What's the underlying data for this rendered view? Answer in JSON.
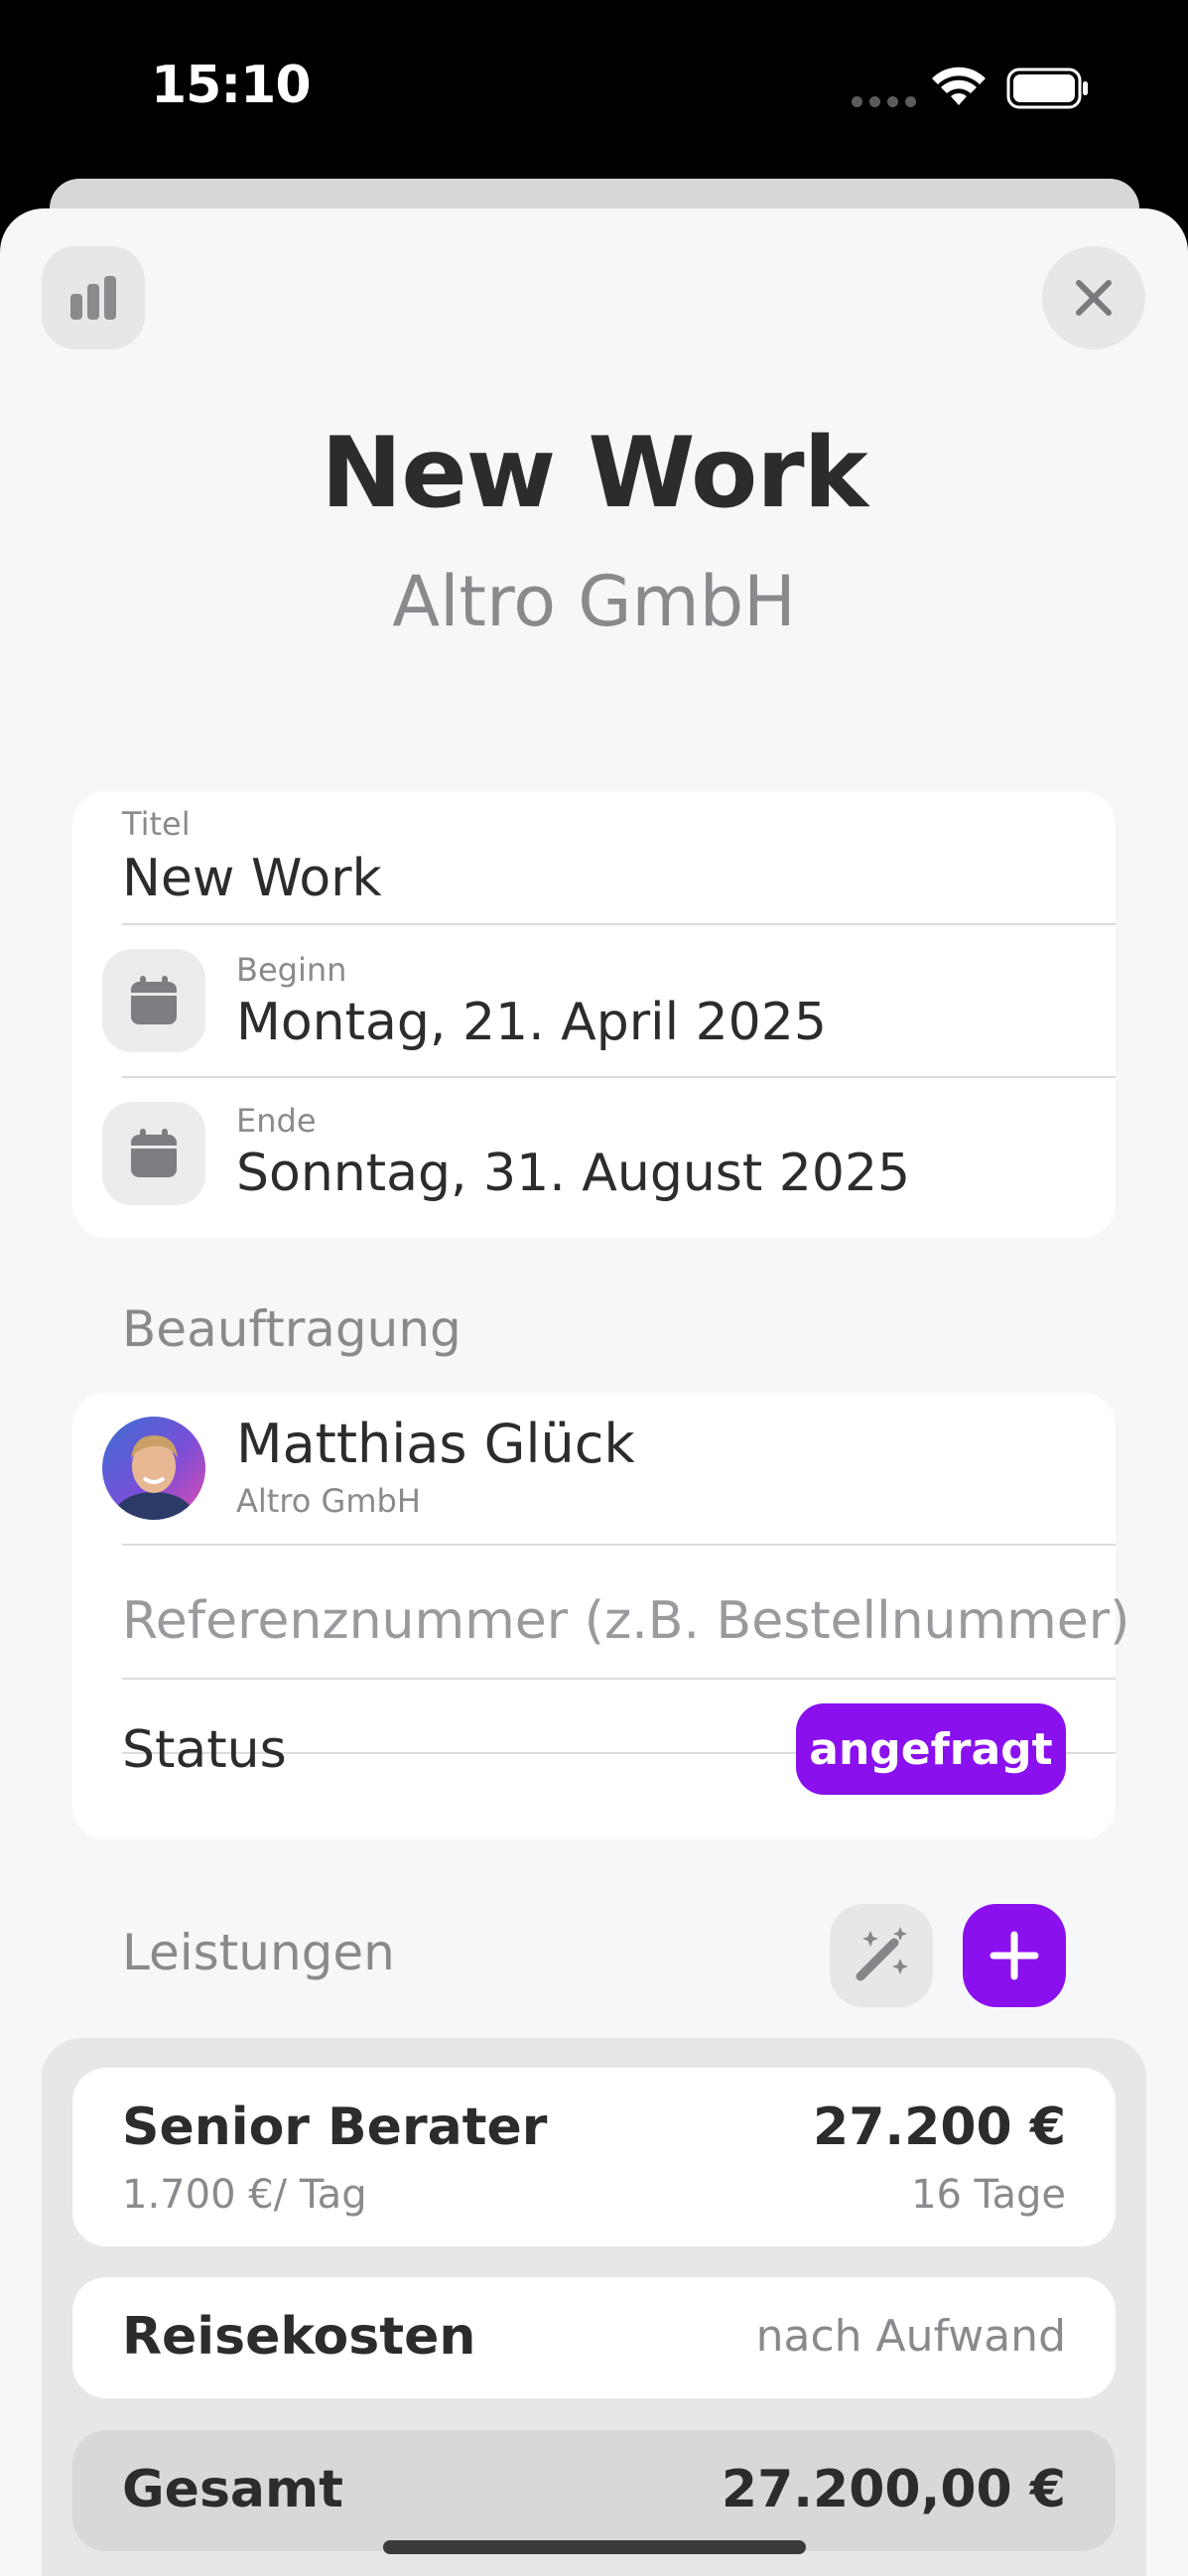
{
  "status_bar": {
    "time": "15:10"
  },
  "header": {
    "title": "New Work",
    "subtitle": "Altro GmbH",
    "stats_icon": "bar-chart-icon",
    "close_icon": "close-icon"
  },
  "details": {
    "title_label": "Titel",
    "title_value": "New Work",
    "begin_label": "Beginn",
    "begin_value": "Montag, 21. April 2025",
    "end_label": "Ende",
    "end_value": "Sonntag, 31. August 2025"
  },
  "assignment": {
    "section_label": "Beauftragung",
    "contact_name": "Matthias Glück",
    "contact_company": "Altro GmbH",
    "reference_placeholder": "Referenznummer (z.B. Bestellnummer)",
    "status_label": "Status",
    "status_value": "angefragt"
  },
  "services": {
    "section_label": "Leistungen",
    "items": [
      {
        "name": "Senior Berater",
        "rate": "1.700 €/ Tag",
        "amount": "27.200 €",
        "quantity": "16 Tage"
      },
      {
        "name": "Reisekosten",
        "note": "nach Aufwand"
      }
    ],
    "total_label": "Gesamt",
    "total_value": "27.200,00 €"
  },
  "colors": {
    "accent": "#8a10ee",
    "background": "#f6f7f9",
    "card": "#ffffff",
    "muted_text": "#8a8a8e"
  }
}
